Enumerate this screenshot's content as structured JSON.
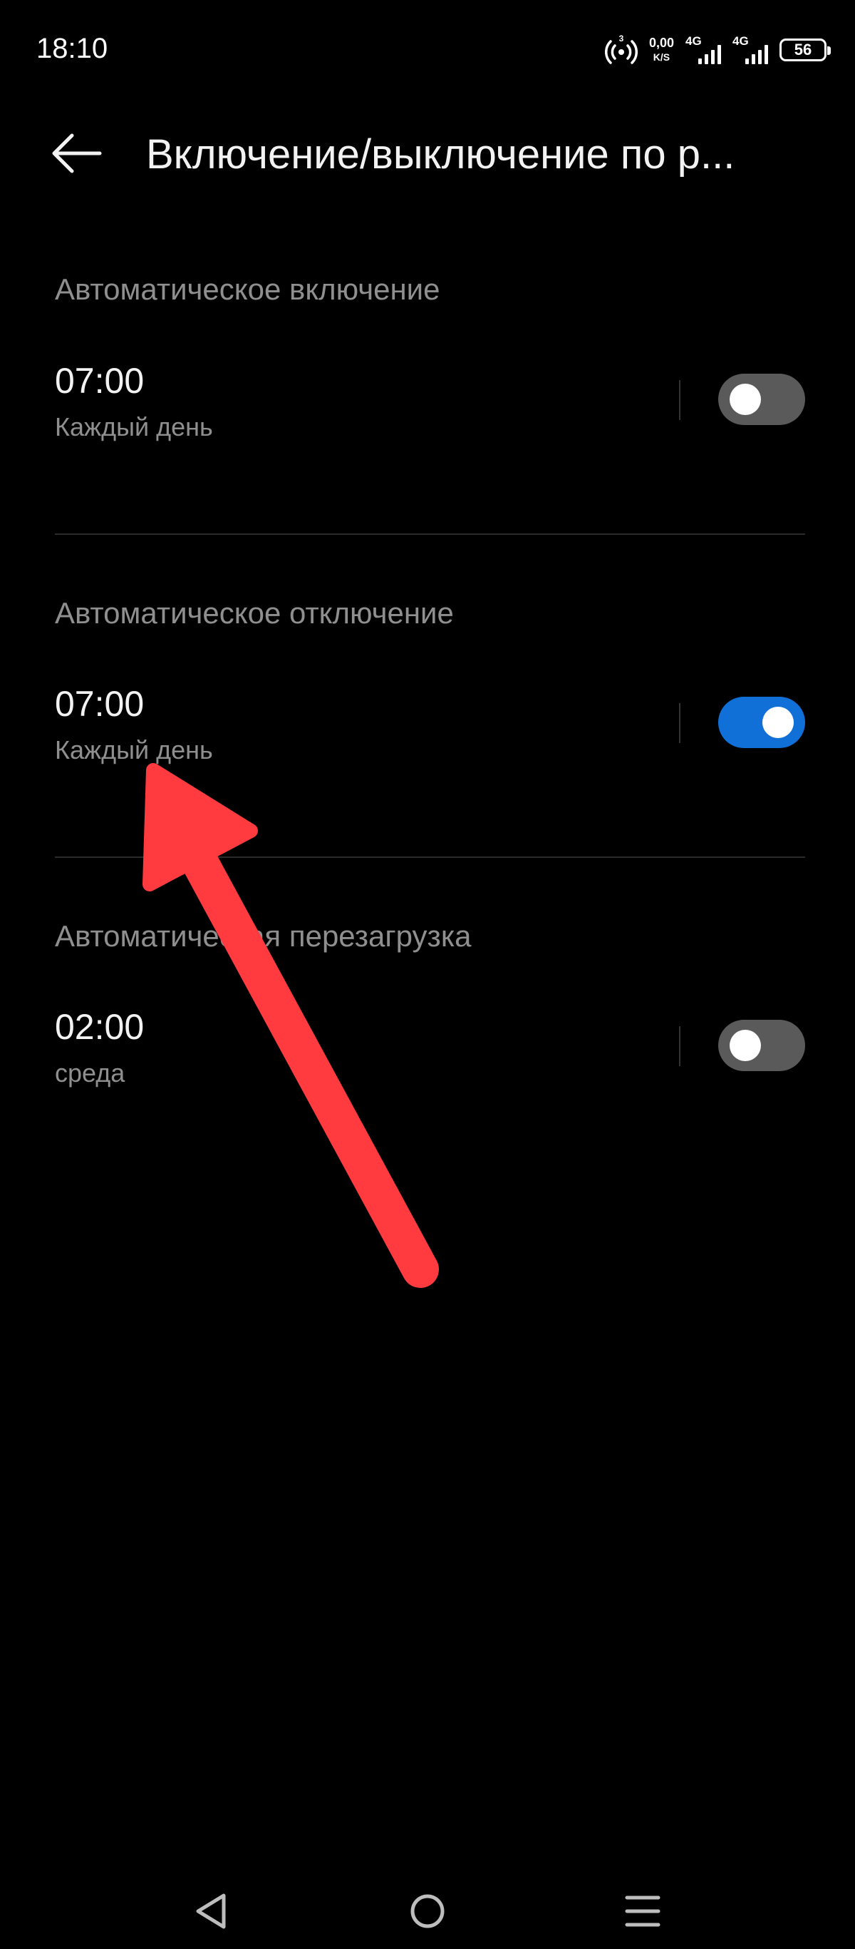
{
  "status_bar": {
    "time": "18:10",
    "hotspot_count": "3",
    "net_speed_value": "0,00",
    "net_speed_unit": "K/S",
    "sim1_label": "4G",
    "sim2_label": "4G",
    "battery": "56"
  },
  "header": {
    "title": "Включение/выключение по р..."
  },
  "sections": [
    {
      "title": "Автоматическое включение",
      "time": "07:00",
      "repeat": "Каждый день",
      "enabled": false
    },
    {
      "title": "Автоматическое отключение",
      "time": "07:00",
      "repeat": "Каждый день",
      "enabled": true
    },
    {
      "title": "Автоматическая перезагрузка",
      "time": "02:00",
      "repeat": "среда",
      "enabled": false
    }
  ],
  "colors": {
    "toggle_on": "#1170d8",
    "toggle_off": "#5a5a5a",
    "annotation_arrow": "#ff3b3f"
  }
}
